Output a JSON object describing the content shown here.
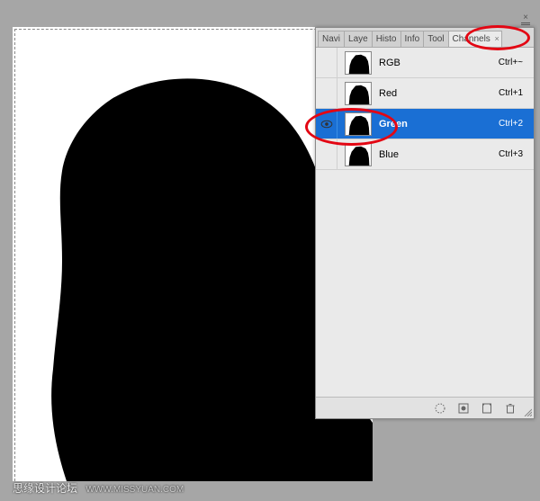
{
  "tabs": {
    "items": [
      "Navi",
      "Laye",
      "Histo",
      "Info",
      "Tool",
      "Channels"
    ],
    "active_index": 5
  },
  "channels": [
    {
      "name": "RGB",
      "shortcut": "Ctrl+~",
      "visible": false,
      "selected": false
    },
    {
      "name": "Red",
      "shortcut": "Ctrl+1",
      "visible": false,
      "selected": false
    },
    {
      "name": "Green",
      "shortcut": "Ctrl+2",
      "visible": true,
      "selected": true
    },
    {
      "name": "Blue",
      "shortcut": "Ctrl+3",
      "visible": false,
      "selected": false
    }
  ],
  "watermark": {
    "text": "思缘设计论坛",
    "url": "WWW.MISSYUAN.COM"
  },
  "icons": {
    "close": "×",
    "tab_close": "×"
  }
}
